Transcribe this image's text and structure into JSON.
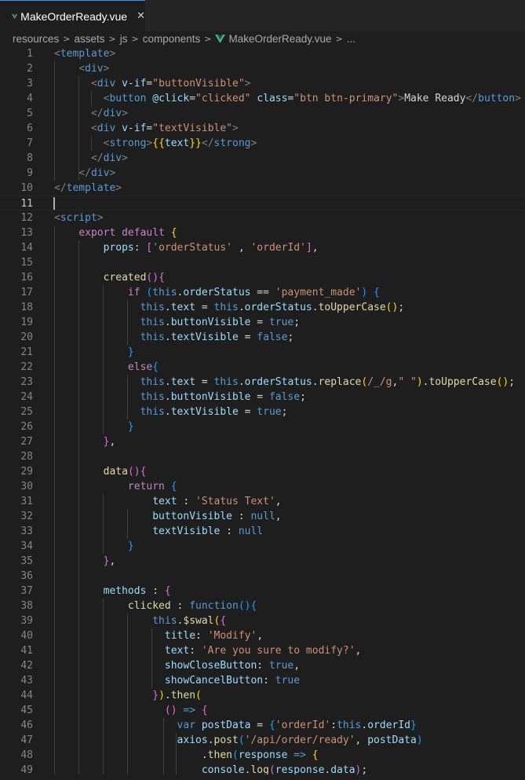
{
  "tab": {
    "filename": "MakeOrderReady.vue",
    "icon": "vue-icon",
    "close_icon": "✕"
  },
  "breadcrumb": {
    "items": [
      "resources",
      "assets",
      "js",
      "components",
      "MakeOrderReady.vue",
      "..."
    ]
  },
  "editor": {
    "current_line": 11,
    "lines": [
      {
        "n": "1",
        "html": "<span class=\"p\">&lt;</span><span class=\"t\">template</span><span class=\"p\">&gt;</span>"
      },
      {
        "n": "2",
        "html": "    <span class=\"p\">&lt;</span><span class=\"t\">div</span><span class=\"p\">&gt;</span>"
      },
      {
        "n": "3",
        "html": "      <span class=\"p\">&lt;</span><span class=\"t\">div</span> <span class=\"a\">v-if</span>=<span class=\"s\">\"buttonVisible\"</span><span class=\"p\">&gt;</span>"
      },
      {
        "n": "4",
        "html": "        <span class=\"p\">&lt;</span><span class=\"t\">button</span> <span class=\"a\">@click</span>=<span class=\"s\">\"clicked\"</span> <span class=\"a\">class</span>=<span class=\"s\">\"btn btn-primary\"</span><span class=\"p\">&gt;</span>Make Ready<span class=\"p\">&lt;/</span><span class=\"t\">button</span><span class=\"p\">&gt;</span>"
      },
      {
        "n": "5",
        "html": "      <span class=\"p\">&lt;/</span><span class=\"t\">div</span><span class=\"p\">&gt;</span>"
      },
      {
        "n": "6",
        "html": "      <span class=\"p\">&lt;</span><span class=\"t\">div</span> <span class=\"a\">v-if</span>=<span class=\"s\">\"textVisible\"</span><span class=\"p\">&gt;</span>"
      },
      {
        "n": "7",
        "html": "        <span class=\"p\">&lt;</span><span class=\"t\">strong</span><span class=\"p\">&gt;</span><span class=\"b1\">{{</span><span class=\"v\">text</span><span class=\"b1\">}}</span><span class=\"p\">&lt;/</span><span class=\"t\">strong</span><span class=\"p\">&gt;</span>"
      },
      {
        "n": "8",
        "html": "      <span class=\"p\">&lt;/</span><span class=\"t\">div</span><span class=\"p\">&gt;</span>"
      },
      {
        "n": "9",
        "html": "    <span class=\"p\">&lt;/</span><span class=\"t\">div</span><span class=\"p\">&gt;</span>"
      },
      {
        "n": "10",
        "html": "<span class=\"p\">&lt;/</span><span class=\"t\">template</span><span class=\"p\">&gt;</span>"
      },
      {
        "n": "11",
        "html": ""
      },
      {
        "n": "12",
        "html": "<span class=\"p\">&lt;</span><span class=\"t\">script</span><span class=\"p\">&gt;</span>"
      },
      {
        "n": "13",
        "html": "    <span class=\"c\">export</span> <span class=\"c\">default</span> <span class=\"b1\">{</span>"
      },
      {
        "n": "14",
        "html": "        <span class=\"v\">props</span>: <span class=\"b2\">[</span><span class=\"s\">'orderStatus'</span> , <span class=\"s\">'orderId'</span><span class=\"b2\">]</span>,"
      },
      {
        "n": "15",
        "html": ""
      },
      {
        "n": "16",
        "html": "        <span class=\"f\">created</span><span class=\"b2\">()</span><span class=\"b2\">{</span>"
      },
      {
        "n": "17",
        "html": "            <span class=\"c\">if</span> <span class=\"b3\">(</span><span class=\"k\">this</span>.<span class=\"v\">orderStatus</span> == <span class=\"s\">'payment_made'</span><span class=\"b3\">)</span> <span class=\"b3\">{</span>"
      },
      {
        "n": "18",
        "html": "              <span class=\"k\">this</span>.<span class=\"v\">text</span> = <span class=\"k\">this</span>.<span class=\"v\">orderStatus</span>.<span class=\"f\">toUpperCase</span><span class=\"b1\">()</span>;"
      },
      {
        "n": "19",
        "html": "              <span class=\"k\">this</span>.<span class=\"v\">buttonVisible</span> = <span class=\"k\">true</span>;"
      },
      {
        "n": "20",
        "html": "              <span class=\"k\">this</span>.<span class=\"v\">textVisible</span> = <span class=\"k\">false</span>;"
      },
      {
        "n": "21",
        "html": "            <span class=\"b3\">}</span>"
      },
      {
        "n": "22",
        "html": "            <span class=\"c\">else</span><span class=\"b3\">{</span>"
      },
      {
        "n": "23",
        "html": "              <span class=\"k\">this</span>.<span class=\"v\">text</span> = <span class=\"k\">this</span>.<span class=\"v\">orderStatus</span>.<span class=\"f\">replace</span><span class=\"b1\">(</span><span class=\"s\">/_/g</span>,<span class=\"s\">\" \"</span><span class=\"b1\">)</span>.<span class=\"f\">toUpperCase</span><span class=\"b1\">()</span>;"
      },
      {
        "n": "24",
        "html": "              <span class=\"k\">this</span>.<span class=\"v\">buttonVisible</span> = <span class=\"k\">false</span>;"
      },
      {
        "n": "25",
        "html": "              <span class=\"k\">this</span>.<span class=\"v\">textVisible</span> = <span class=\"k\">true</span>;"
      },
      {
        "n": "26",
        "html": "            <span class=\"b3\">}</span>"
      },
      {
        "n": "27",
        "html": "        <span class=\"b2\">}</span>,"
      },
      {
        "n": "28",
        "html": ""
      },
      {
        "n": "29",
        "html": "        <span class=\"f\">data</span><span class=\"b2\">()</span><span class=\"b2\">{</span>"
      },
      {
        "n": "30",
        "html": "            <span class=\"c\">return</span> <span class=\"b3\">{</span>"
      },
      {
        "n": "31",
        "html": "                <span class=\"v\">text</span> : <span class=\"s\">'Status Text'</span>,"
      },
      {
        "n": "32",
        "html": "                <span class=\"v\">buttonVisible</span> : <span class=\"k\">null</span>,"
      },
      {
        "n": "33",
        "html": "                <span class=\"v\">textVisible</span> : <span class=\"k\">null</span>"
      },
      {
        "n": "34",
        "html": "            <span class=\"b3\">}</span>"
      },
      {
        "n": "35",
        "html": "        <span class=\"b2\">}</span>,"
      },
      {
        "n": "36",
        "html": ""
      },
      {
        "n": "37",
        "html": "        <span class=\"v\">methods</span> : <span class=\"b2\">{</span>"
      },
      {
        "n": "38",
        "html": "            <span class=\"f\">clicked</span> : <span class=\"k\">function</span><span class=\"b3\">()</span><span class=\"b3\">{</span>"
      },
      {
        "n": "39",
        "html": "                <span class=\"k\">this</span>.<span class=\"f\">$swal</span><span class=\"b1\">(</span><span class=\"b2\">{</span>"
      },
      {
        "n": "40",
        "html": "                  <span class=\"v\">title</span>: <span class=\"s\">'Modify'</span>,"
      },
      {
        "n": "41",
        "html": "                  <span class=\"v\">text</span>: <span class=\"s\">'Are you sure to modify?'</span>,"
      },
      {
        "n": "42",
        "html": "                  <span class=\"v\">showCloseButton</span>: <span class=\"k\">true</span>,"
      },
      {
        "n": "43",
        "html": "                  <span class=\"v\">showCancelButton</span>: <span class=\"k\">true</span>"
      },
      {
        "n": "44",
        "html": "                <span class=\"b2\">}</span><span class=\"b1\">)</span>.<span class=\"f\">then</span><span class=\"b1\">(</span>"
      },
      {
        "n": "45",
        "html": "                  <span class=\"b2\">()</span> <span class=\"k\">=&gt;</span> <span class=\"b2\">{</span>"
      },
      {
        "n": "46",
        "html": "                    <span class=\"k\">var</span> <span class=\"v\">postData</span> = <span class=\"b3\">{</span><span class=\"s\">'orderId'</span>:<span class=\"k\">this</span>.<span class=\"v\">orderId</span><span class=\"b3\">}</span>"
      },
      {
        "n": "47",
        "html": "                    <span class=\"v\">axios</span>.<span class=\"f\">post</span><span class=\"b3\">(</span><span class=\"s\">'/api/order/ready'</span>, <span class=\"v\">postData</span><span class=\"b3\">)</span>"
      },
      {
        "n": "48",
        "html": "                        .<span class=\"f\">then</span><span class=\"b3\">(</span><span class=\"v\">response</span> <span class=\"k\">=&gt;</span> <span class=\"b1\">{</span>"
      },
      {
        "n": "49",
        "html": "                        <span class=\"v\">console</span>.<span class=\"f\">log</span><span class=\"b2\">(</span><span class=\"v\">response</span>.<span class=\"v\">data</span><span class=\"b2\">)</span>;"
      }
    ]
  }
}
